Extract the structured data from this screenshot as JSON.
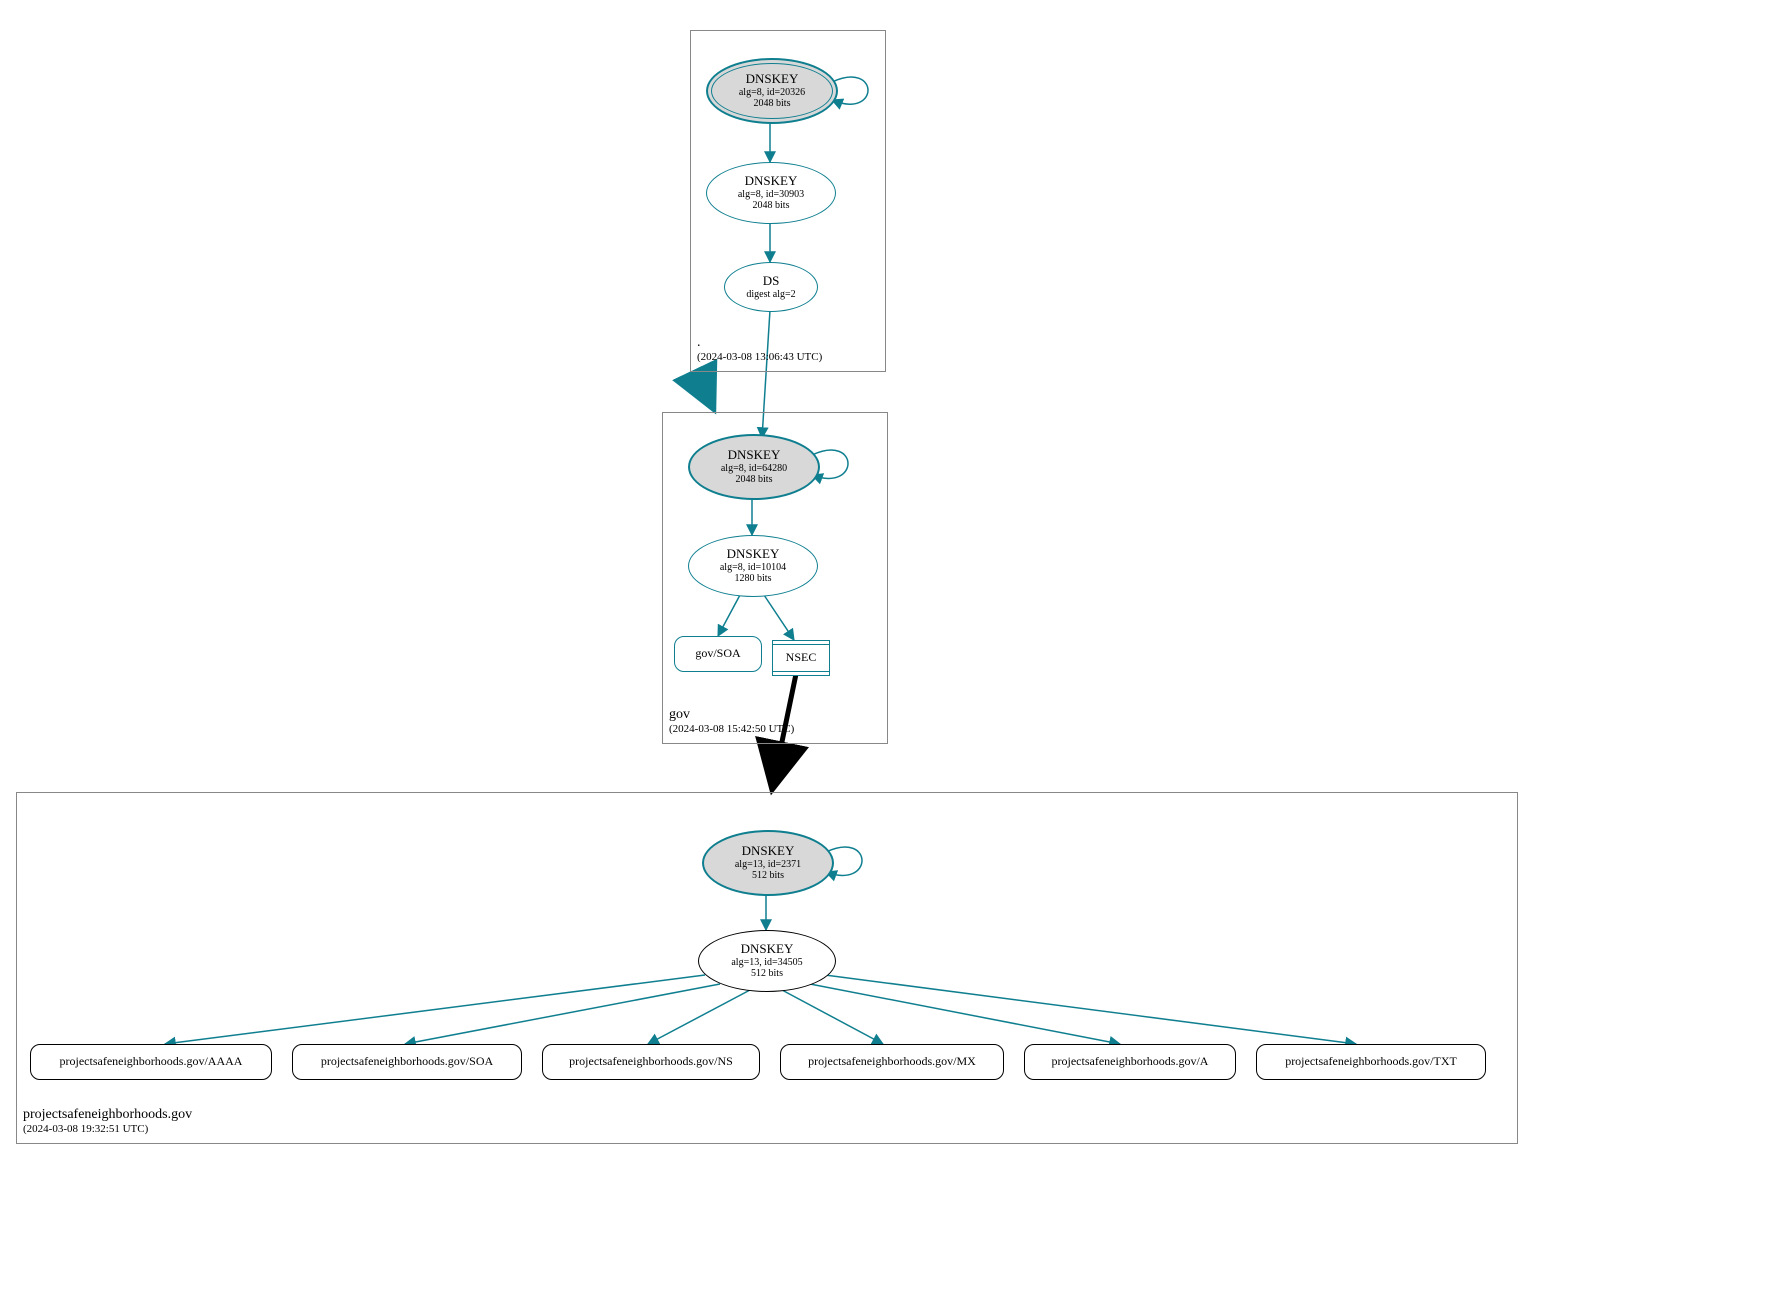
{
  "zones": {
    "root": {
      "name": ".",
      "timestamp": "(2024-03-08 13:06:43 UTC)"
    },
    "gov": {
      "name": "gov",
      "timestamp": "(2024-03-08 15:42:50 UTC)"
    },
    "psn": {
      "name": "projectsafeneighborhoods.gov",
      "timestamp": "(2024-03-08 19:32:51 UTC)"
    }
  },
  "nodes": {
    "root_ksk": {
      "title": "DNSKEY",
      "line2": "alg=8, id=20326",
      "line3": "2048 bits"
    },
    "root_zsk": {
      "title": "DNSKEY",
      "line2": "alg=8, id=30903",
      "line3": "2048 bits"
    },
    "root_ds": {
      "title": "DS",
      "line2": "digest alg=2"
    },
    "gov_ksk": {
      "title": "DNSKEY",
      "line2": "alg=8, id=64280",
      "line3": "2048 bits"
    },
    "gov_zsk": {
      "title": "DNSKEY",
      "line2": "alg=8, id=10104",
      "line3": "1280 bits"
    },
    "gov_soa": {
      "label": "gov/SOA"
    },
    "gov_nsec": {
      "label": "NSEC"
    },
    "psn_ksk": {
      "title": "DNSKEY",
      "line2": "alg=13, id=2371",
      "line3": "512 bits"
    },
    "psn_zsk": {
      "title": "DNSKEY",
      "line2": "alg=13, id=34505",
      "line3": "512 bits"
    },
    "psn_aaaa": {
      "label": "projectsafeneighborhoods.gov/AAAA"
    },
    "psn_soa": {
      "label": "projectsafeneighborhoods.gov/SOA"
    },
    "psn_ns": {
      "label": "projectsafeneighborhoods.gov/NS"
    },
    "psn_mx": {
      "label": "projectsafeneighborhoods.gov/MX"
    },
    "psn_a": {
      "label": "projectsafeneighborhoods.gov/A"
    },
    "psn_txt": {
      "label": "projectsafeneighborhoods.gov/TXT"
    }
  },
  "colors": {
    "teal": "#0f7f90",
    "black": "#000000",
    "grayFill": "#d8d8d8"
  }
}
